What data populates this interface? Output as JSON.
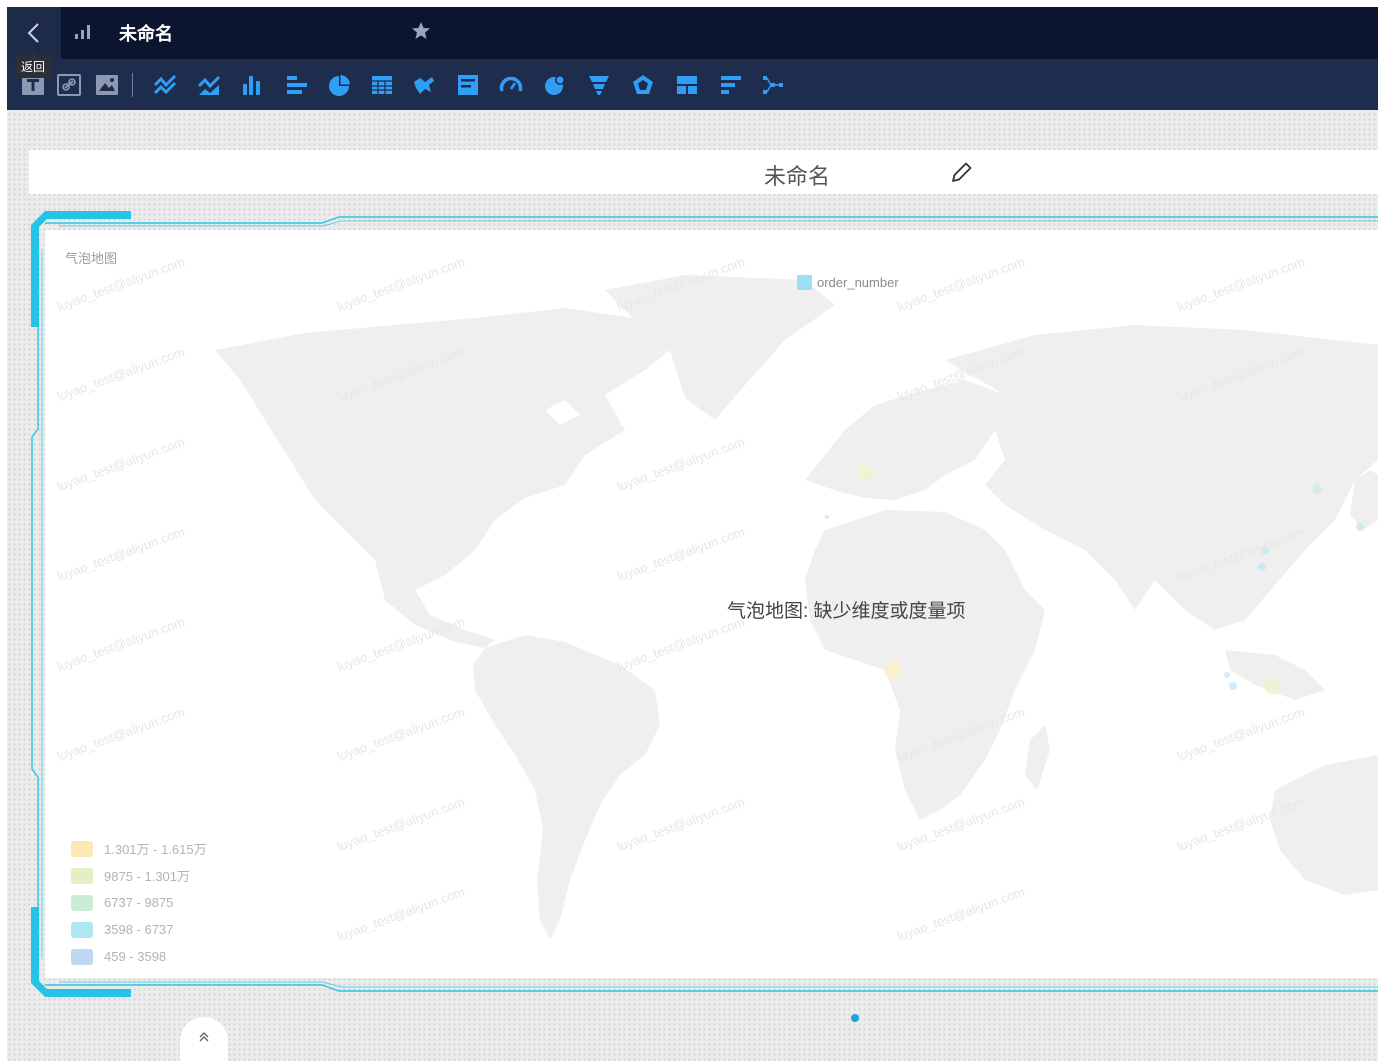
{
  "header": {
    "back_tooltip": "返回",
    "report_name": "未命名"
  },
  "toolbar": {
    "tools": [
      "text-icon",
      "link-icon",
      "image-icon",
      "line-chart-icon",
      "area-chart-icon",
      "column-chart-icon",
      "bar-chart-icon",
      "pie-chart-icon",
      "table-icon",
      "map-icon",
      "kpi-icon",
      "gauge-icon",
      "bubble-map-icon",
      "funnel-icon",
      "radar-icon",
      "cross-table-icon",
      "ranking-icon",
      "tree-icon"
    ]
  },
  "canvas": {
    "title": "未命名"
  },
  "chart": {
    "label": "气泡地图",
    "series_legend": "order_number",
    "empty_message": "气泡地图: 缺少维度或度量项",
    "watermark": "luyao_test@aliyun.com",
    "colors": {
      "accent": "#27c3e6",
      "land": "#efefef",
      "topbar": "#0c1530",
      "toolbar": "#1e2c4e"
    }
  },
  "chart_data": {
    "type": "scatter",
    "map": "world",
    "legend": [
      {
        "label": "1.301万 - 1.615万",
        "color": "#fde7b4"
      },
      {
        "label": "9875 - 1.301万",
        "color": "#e5f0c2"
      },
      {
        "label": "6737 - 9875",
        "color": "#c9ecd6"
      },
      {
        "label": "3598 - 6737",
        "color": "#aee6f3"
      },
      {
        "label": "459 - 3598",
        "color": "#bcd8f3"
      }
    ]
  },
  "footer": {
    "collapse_icon": "double-chevron-up-icon",
    "page_indicator": "page-dot"
  }
}
